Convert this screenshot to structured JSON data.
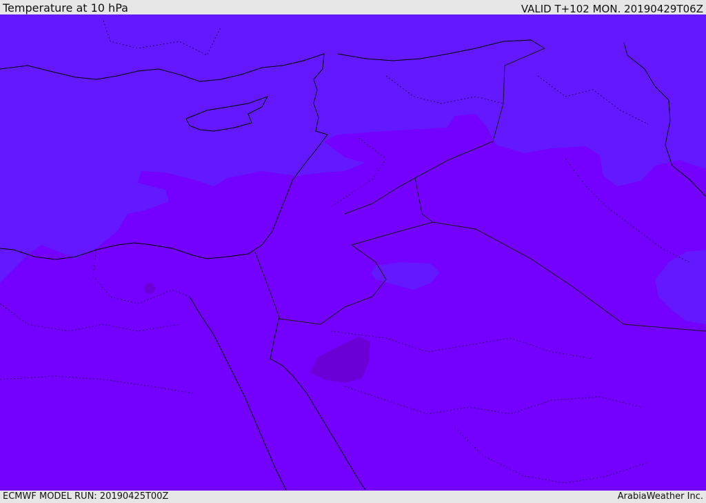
{
  "header": {
    "title": "Temperature at 10 hPa",
    "valid": "VALID T+102 MON. 20190429T06Z"
  },
  "footer": {
    "model_run": "ECMWF MODEL RUN: 20190425T00Z",
    "credit": "ArabiaWeather Inc."
  },
  "colors": {
    "background_field": "#7400ff",
    "cold_field": "#6418ff",
    "coldest_patch": "#6a00d6",
    "coastline": "#000000",
    "border_line": "#1a1a1a"
  }
}
